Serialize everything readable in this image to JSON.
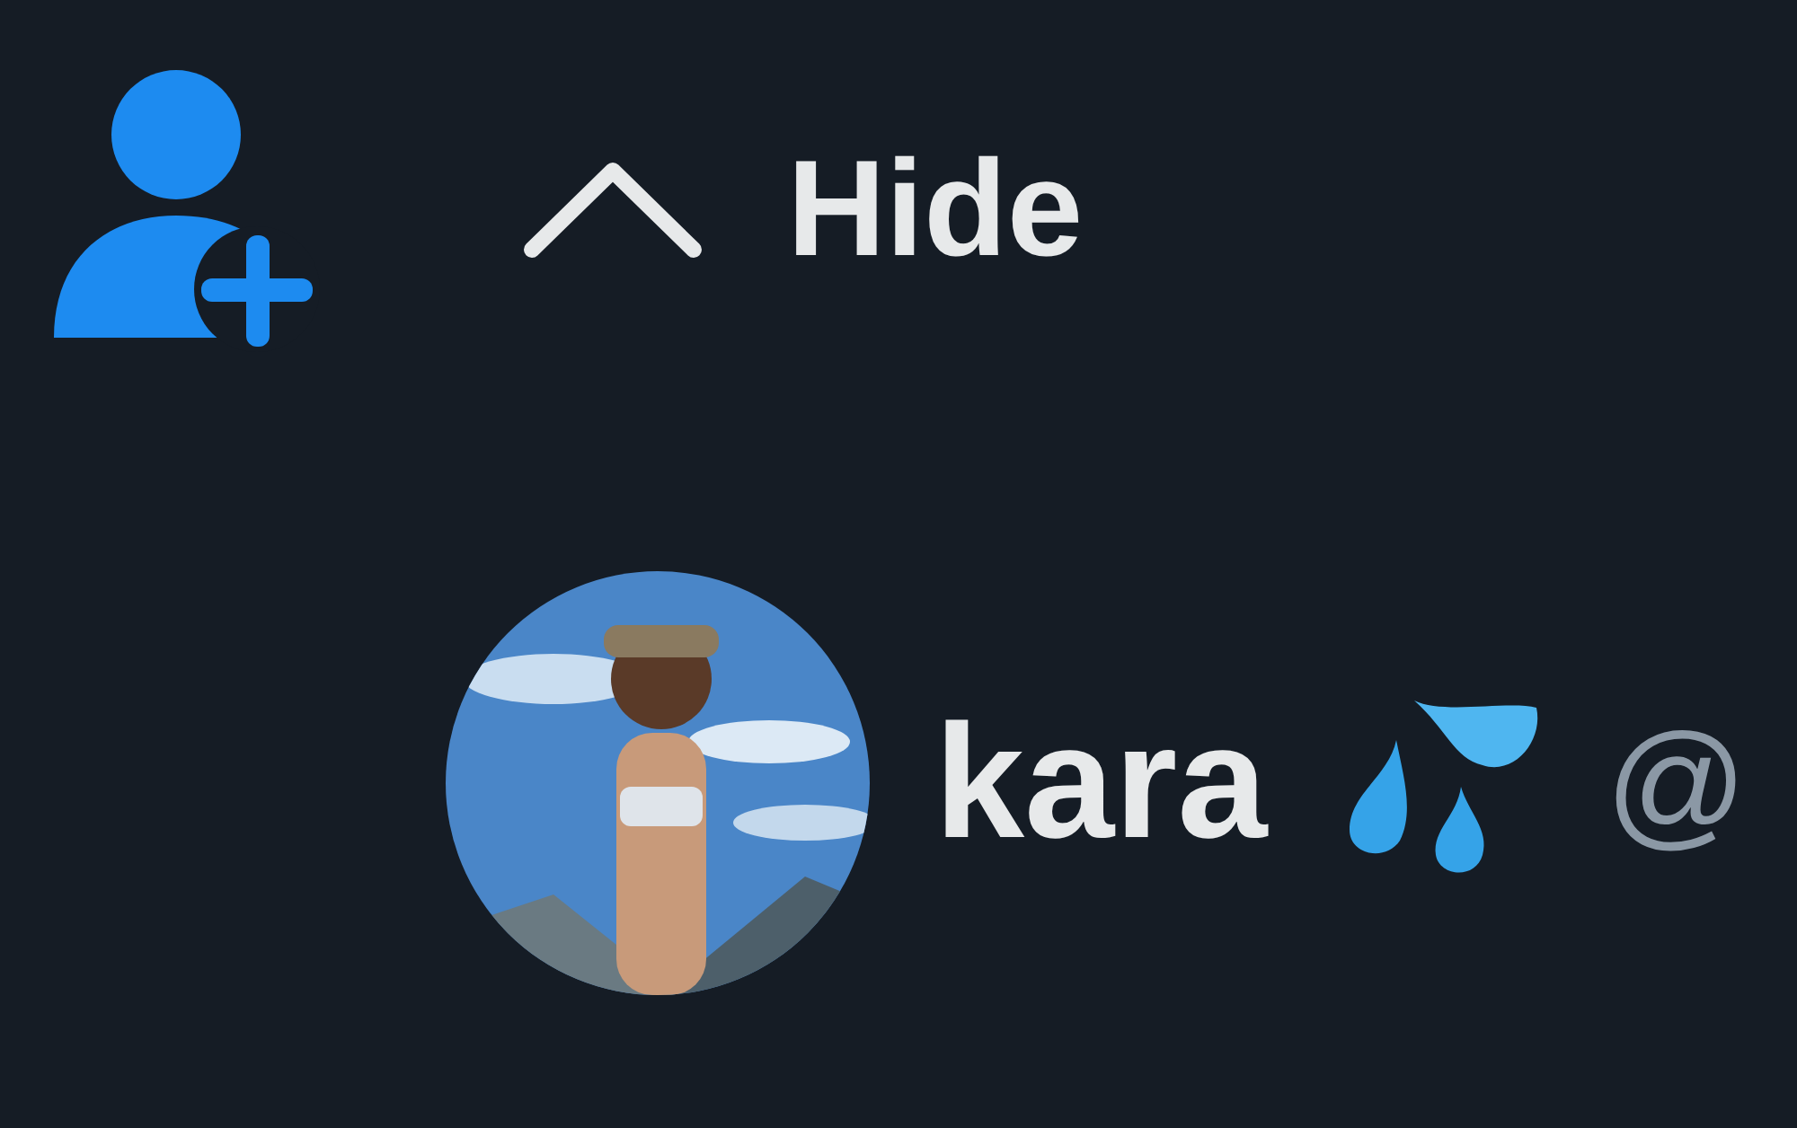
{
  "toggle": {
    "label": "Hide",
    "expanded": true
  },
  "user": {
    "name": "kara",
    "handle": "@"
  }
}
